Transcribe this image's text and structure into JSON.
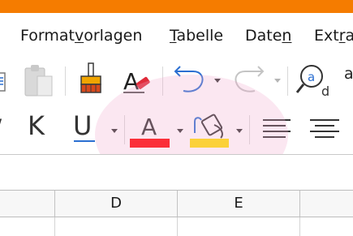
{
  "colors": {
    "titlebar": "#f57c00",
    "font_color_bar": "#ff0000",
    "highlight_bar": "#ffe100",
    "undo_blue": "#2b6fd1",
    "highlight_overlay": "#f7d3e4"
  },
  "menu": {
    "items": [
      {
        "text": "Formatvorlagen",
        "mnemonic": "v"
      },
      {
        "text": "Tabelle",
        "mnemonic": "T"
      },
      {
        "text": "Daten",
        "mnemonic": "n"
      },
      {
        "text": "Extras",
        "mnemonic": "r"
      }
    ]
  },
  "toolbar": {
    "row1": [
      "paste-icon",
      "clipboard-icon",
      "clone-formatting-icon",
      "clear-formatting-icon",
      "undo-icon",
      "redo-icon",
      "find-replace-icon",
      "spelling-icon"
    ],
    "row2": {
      "italic_label": "K",
      "underline_label": "U",
      "font_color_label": "A",
      "icons": [
        "underline-icon",
        "font-color-icon",
        "highlight-color-icon",
        "align-left-icon",
        "align-center-icon"
      ]
    },
    "find_replace_glyph": "a",
    "spelling_glyph": "a"
  },
  "sheet": {
    "columns": [
      "",
      "D",
      "E",
      ""
    ]
  }
}
